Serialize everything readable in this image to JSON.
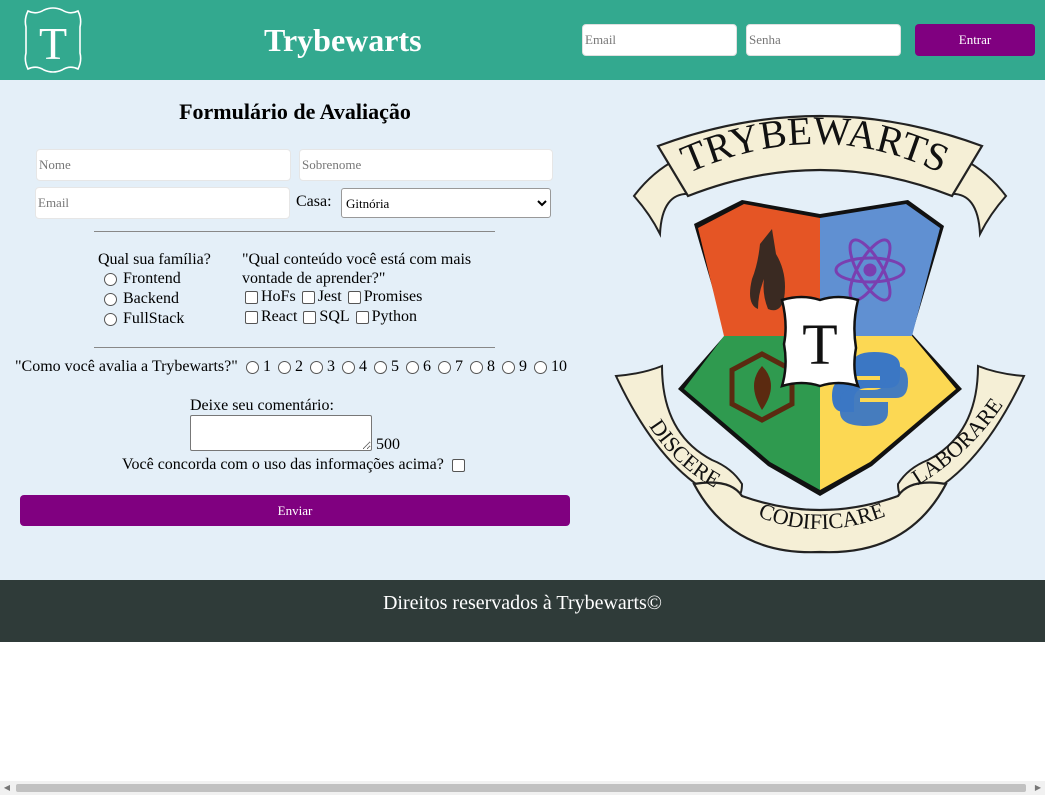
{
  "header": {
    "logo_letter": "T",
    "title": "Trybewarts",
    "email_placeholder": "Email",
    "password_placeholder": "Senha",
    "login_button": "Entrar",
    "accent_color": "#33a98f",
    "button_color": "#800080"
  },
  "form": {
    "title": "Formulário de Avaliação",
    "name_placeholder": "Nome",
    "lastname_placeholder": "Sobrenome",
    "email_placeholder": "Email",
    "house_label": "Casa:",
    "house_selected": "Gitnória",
    "family_question": "Qual sua família?",
    "families": [
      "Frontend",
      "Backend",
      "FullStack"
    ],
    "content_question_line1": "\"Qual conteúdo você está com mais",
    "content_question_line2": "vontade de aprender?\"",
    "contents": [
      "HoFs",
      "Jest",
      "Promises",
      "React",
      "SQL",
      "Python"
    ],
    "rating_question": "\"Como você avalia a Trybewarts?\"",
    "ratings": [
      "1",
      "2",
      "3",
      "4",
      "5",
      "6",
      "7",
      "8",
      "9",
      "10"
    ],
    "comment_label": "Deixe seu comentário:",
    "char_counter": "500",
    "agreement_label": "Você concorda com o uso das informações acima?",
    "submit_button": "Enviar"
  },
  "crest": {
    "banner_top": "TRYBEWARTS",
    "center_letter": "T",
    "motto_left": "DISCERE",
    "motto_middle": "CODIFICARE",
    "motto_right": "LABORARE",
    "colors": {
      "red": "#e55525",
      "blue": "#6090d2",
      "green": "#2f9a4f",
      "yellow": "#fcd853",
      "ribbon": "#f5efd6"
    }
  },
  "footer": {
    "text": "Direitos reservados à Trybewarts©",
    "background": "#2f3b39"
  }
}
